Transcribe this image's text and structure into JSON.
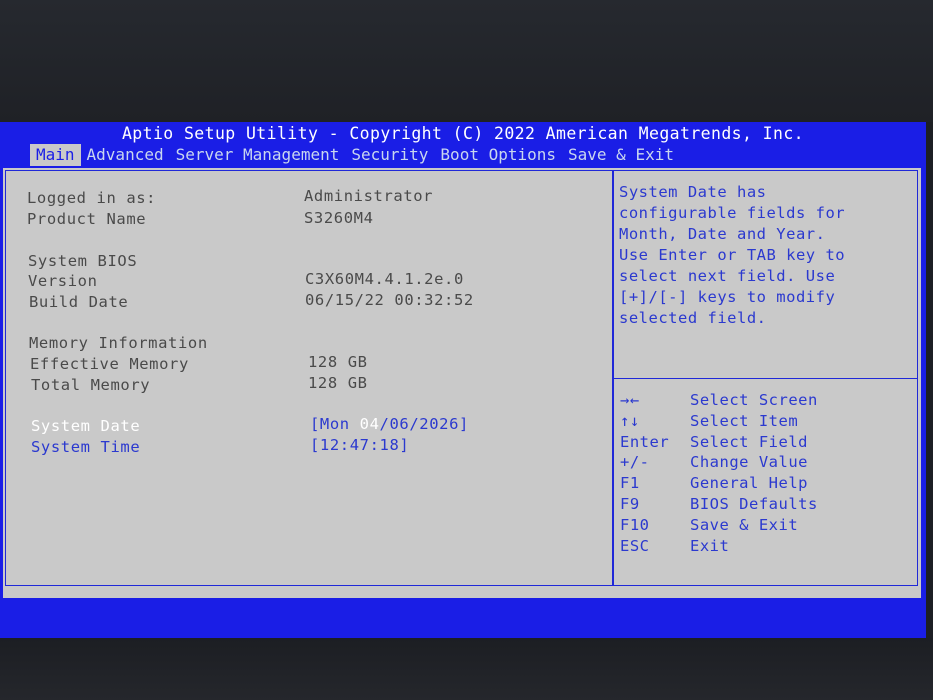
{
  "header": {
    "title": "Aptio Setup Utility - Copyright (C) 2022 American Megatrends, Inc."
  },
  "tabs": [
    {
      "label": "Main",
      "active": true
    },
    {
      "label": "Advanced",
      "active": false
    },
    {
      "label": "Server Management",
      "active": false
    },
    {
      "label": "Security",
      "active": false
    },
    {
      "label": "Boot Options",
      "active": false
    },
    {
      "label": "Save & Exit",
      "active": false
    }
  ],
  "main": {
    "logged_in": {
      "label": "Logged in as:",
      "value": "Administrator"
    },
    "product": {
      "label": "Product Name",
      "value": "S3260M4"
    },
    "bios_header": "System BIOS",
    "version": {
      "label": "Version",
      "value": "C3X60M4.4.1.2e.0"
    },
    "build_date": {
      "label": "Build Date",
      "value": "06/15/22 00:32:52"
    },
    "memory_header": "Memory Information",
    "effective_memory": {
      "label": "Effective Memory",
      "value": "128 GB"
    },
    "total_memory": {
      "label": "Total Memory",
      "value": "128 GB"
    },
    "system_date": {
      "label": "System Date",
      "prefix": "[Mon ",
      "highlight": "04",
      "suffix": "/06/2026]"
    },
    "system_time": {
      "label": "System Time",
      "value": "[12:47:18]"
    }
  },
  "help": {
    "lines": [
      "System Date has",
      "configurable fields for",
      "Month, Date and Year.",
      "Use Enter or TAB key to",
      "select next field. Use",
      "[+]/[-] keys to modify",
      "selected field."
    ]
  },
  "keys": [
    {
      "key": "→←",
      "desc": "Select Screen"
    },
    {
      "key": "↑↓",
      "desc": "Select Item"
    },
    {
      "key": "Enter",
      "desc": "Select Field"
    },
    {
      "key": "+/-",
      "desc": "Change Value"
    },
    {
      "key": "F1",
      "desc": "General Help"
    },
    {
      "key": "F9",
      "desc": "BIOS Defaults"
    },
    {
      "key": "F10",
      "desc": "Save & Exit"
    },
    {
      "key": "ESC",
      "desc": "Exit"
    }
  ],
  "colors": {
    "bios_blue": "#1a1ee6",
    "panel_gray": "#c9c9c9",
    "text_gray": "#4a4a4a",
    "text_blue": "#2b39cf",
    "highlight_white": "#ffffff"
  }
}
